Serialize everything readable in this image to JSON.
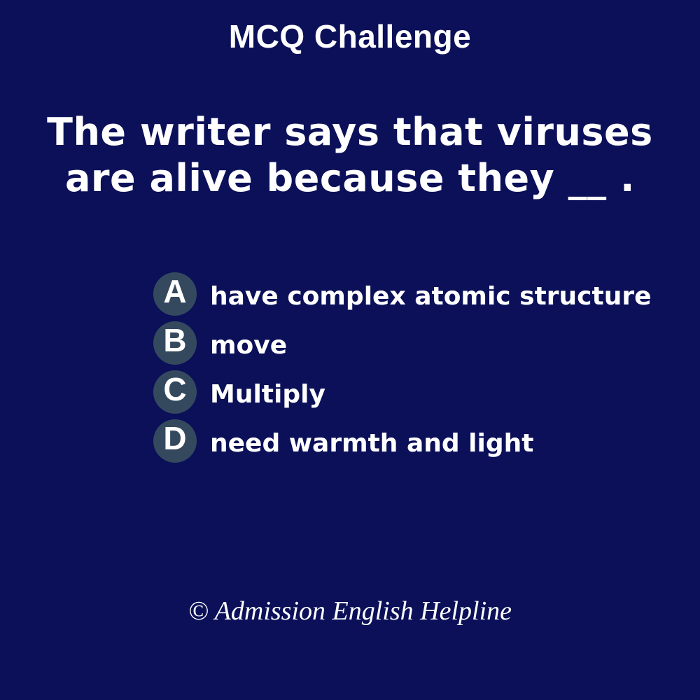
{
  "header": {
    "title": "MCQ Challenge"
  },
  "question": {
    "text": "The writer says that viruses\nare alive because they __ ."
  },
  "options": [
    {
      "letter": "A",
      "text": "have complex atomic structure"
    },
    {
      "letter": "B",
      "text": "move"
    },
    {
      "letter": "C",
      "text": "Multiply"
    },
    {
      "letter": "D",
      "text": "need warmth and light"
    }
  ],
  "footer": {
    "copyright": "© Admission English Helpline"
  },
  "colors": {
    "background": "#0b1059",
    "badge": "#34495e",
    "text": "#ffffff"
  }
}
